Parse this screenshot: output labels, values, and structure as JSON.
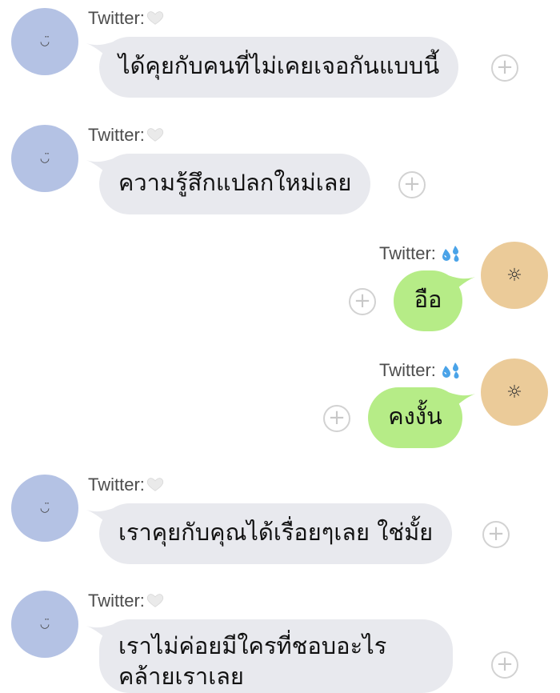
{
  "messages": [
    {
      "side": "left",
      "sender": "Twitter:",
      "sender_icon": "white-heart-icon",
      "avatar_glyph": "◡̈",
      "text": "ได้คุยกับคนที่ไม่เคยเจอกันแบบนี้"
    },
    {
      "side": "left",
      "sender": "Twitter:",
      "sender_icon": "white-heart-icon",
      "avatar_glyph": "◡̈",
      "text": "ความรู้สึกแปลกใหม่เลย"
    },
    {
      "side": "right",
      "sender": "Twitter:",
      "sender_icon": "sweat-droplets-icon",
      "avatar_glyph": "☼",
      "text": "อือ"
    },
    {
      "side": "right",
      "sender": "Twitter:",
      "sender_icon": "sweat-droplets-icon",
      "avatar_glyph": "☼",
      "text": "คงงั้น"
    },
    {
      "side": "left",
      "sender": "Twitter:",
      "sender_icon": "white-heart-icon",
      "avatar_glyph": "◡̈",
      "text": "เราคุยกับคุณได้เรื่อยๆเลย ใช่มั้ย"
    },
    {
      "side": "left",
      "sender": "Twitter:",
      "sender_icon": "white-heart-icon",
      "avatar_glyph": "◡̈",
      "text": "เราไม่ค่อยมีใครที่ชอบอะไรคล้ายเราเลย"
    }
  ],
  "plus_glyph": "+",
  "colors": {
    "incoming_bubble": "#e8e9ee",
    "outgoing_bubble": "#b6ec87",
    "incoming_avatar": "#b4c2e4",
    "outgoing_avatar": "#ebcb99",
    "sender_text": "#4d4d4d"
  }
}
